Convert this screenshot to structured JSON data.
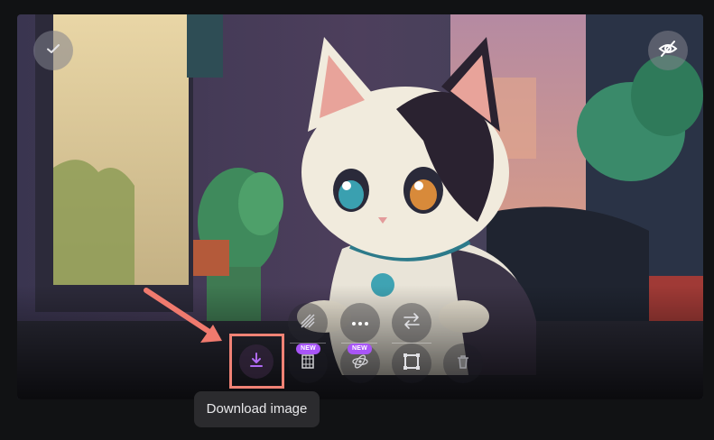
{
  "tooltip": {
    "text": "Download image"
  },
  "toolbar": {
    "top_row": [
      {
        "icon": "upscale-icon"
      },
      {
        "icon": "more-icon"
      },
      {
        "icon": "swap-icon"
      }
    ],
    "bottom_row": [
      {
        "icon": "download-icon",
        "accent": "#a855f7"
      },
      {
        "icon": "video-icon",
        "badge": "NEW"
      },
      {
        "icon": "3d-object-icon",
        "badge": "NEW"
      },
      {
        "icon": "crop-icon"
      },
      {
        "icon": "trash-icon"
      }
    ]
  },
  "colors": {
    "highlight": "#f08275",
    "badge": "#a855f7",
    "background": "#111214"
  },
  "image": {
    "subject": "anime-style calico kitten sitting at a desk with a monitor and plants"
  }
}
